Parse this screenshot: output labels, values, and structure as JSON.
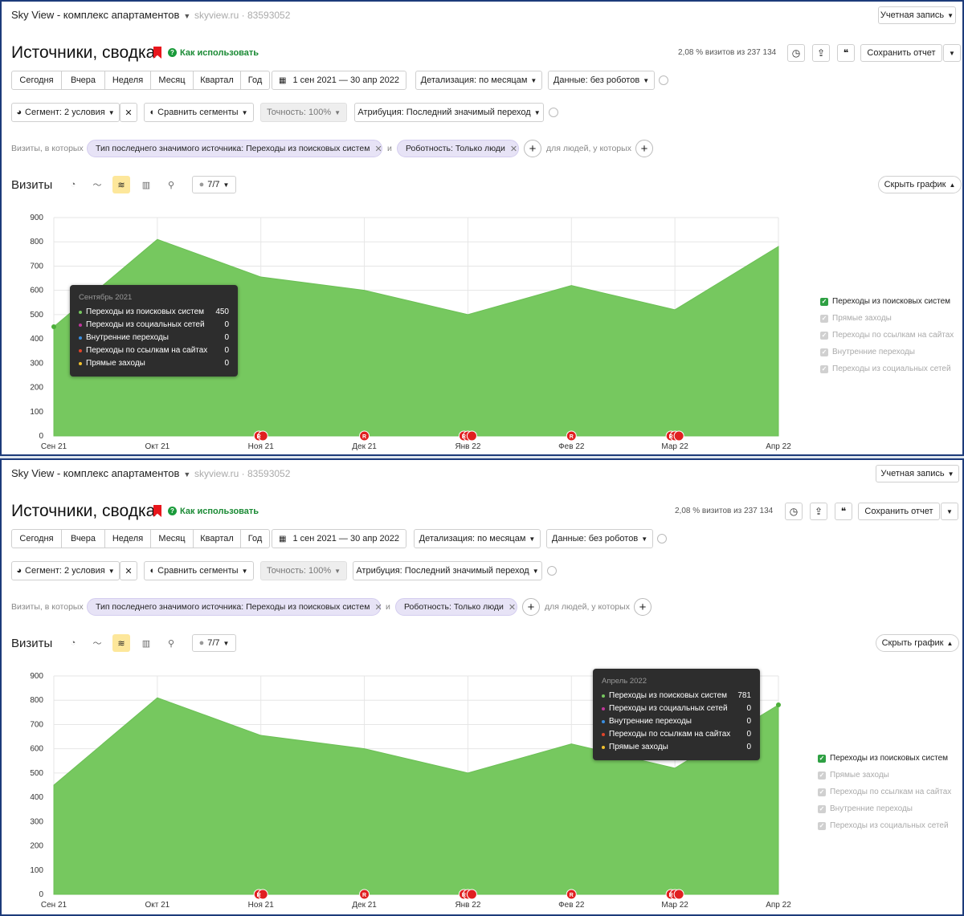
{
  "app": {
    "title": "Sky View - комплекс апартаментов",
    "counter": "skyview.ru · 83593052",
    "account_button": "Учетная запись"
  },
  "header": {
    "report_title": "Источники, сводка",
    "help_link": "Как использовать",
    "visits_share": "2,08 % визитов из 237 134",
    "save_report": "Сохранить отчет"
  },
  "periods": [
    "Сегодня",
    "Вчера",
    "Неделя",
    "Месяц",
    "Квартал",
    "Год"
  ],
  "date_range": "1 сен 2021 — 30 апр 2022",
  "detail": "Детализация: по месяцам",
  "data_filter": "Данные: без роботов",
  "segment": "Сегмент: 2 условия",
  "compare_segments": "Сравнить сегменты",
  "accuracy": "Точность: 100%",
  "attribution": "Атрибуция: Последний значимый переход",
  "filters": {
    "prefix": "Визиты, в которых",
    "chip1": "Тип последнего значимого источника: Переходы из поисковых систем",
    "and_word": "и",
    "chip2": "Роботность: Только люди",
    "people_text": "для людей, у которых"
  },
  "chart_toolbar": {
    "title": "Визиты",
    "series_count": "7/7",
    "hide_chart": "Скрыть график"
  },
  "legend": [
    {
      "label": "Переходы из поисковых систем",
      "checked": true
    },
    {
      "label": "Прямые заходы",
      "checked": false
    },
    {
      "label": "Переходы по ссылкам на сайтах",
      "checked": false
    },
    {
      "label": "Внутренние переходы",
      "checked": false
    },
    {
      "label": "Переходы из социальных сетей",
      "checked": false
    }
  ],
  "colors": {
    "area": "#76c85f",
    "accent_green": "#1a9b3b",
    "tooltip_bg": "#2d2d2d",
    "chip_bg": "#e7e3f6",
    "annotation_red": "#e02020"
  },
  "tooltips": [
    {
      "title": "Сентябрь 2021",
      "rows": [
        {
          "label": "Переходы из поисковых систем",
          "value": "450",
          "color": "#76c85f"
        },
        {
          "label": "Переходы из социальных сетей",
          "value": "0",
          "color": "#c0369b"
        },
        {
          "label": "Внутренние переходы",
          "value": "0",
          "color": "#3a8ee0"
        },
        {
          "label": "Переходы по ссылкам на сайтах",
          "value": "0",
          "color": "#e0442a"
        },
        {
          "label": "Прямые заходы",
          "value": "0",
          "color": "#f2c12e"
        }
      ]
    },
    {
      "title": "Апрель 2022",
      "rows": [
        {
          "label": "Переходы из поисковых систем",
          "value": "781",
          "color": "#76c85f"
        },
        {
          "label": "Переходы из социальных сетей",
          "value": "0",
          "color": "#c0369b"
        },
        {
          "label": "Внутренние переходы",
          "value": "0",
          "color": "#3a8ee0"
        },
        {
          "label": "Переходы по ссылкам на сайтах",
          "value": "0",
          "color": "#e0442a"
        },
        {
          "label": "Прямые заходы",
          "value": "0",
          "color": "#f2c12e"
        }
      ]
    }
  ],
  "chart_data": {
    "type": "area",
    "x": [
      "Сен 21",
      "Окт 21",
      "Ноя 21",
      "Дек 21",
      "Янв 22",
      "Фев 22",
      "Мар 22",
      "Апр 22"
    ],
    "series": [
      {
        "name": "Переходы из поисковых систем",
        "values": [
          450,
          810,
          655,
          600,
          500,
          620,
          520,
          781
        ]
      }
    ],
    "yticks": [
      0,
      100,
      200,
      300,
      400,
      500,
      600,
      700,
      800,
      900
    ],
    "ylim": [
      0,
      900
    ],
    "grid": true,
    "annotation_glyph": "R",
    "annotation_marks": [
      {
        "x": "Ноя 21",
        "count": 2
      },
      {
        "x": "Дек 21",
        "count": 1
      },
      {
        "x": "Янв 22",
        "count": 3
      },
      {
        "x": "Фев 22",
        "count": 1
      },
      {
        "x": "Мар 22",
        "count": 3
      }
    ]
  }
}
